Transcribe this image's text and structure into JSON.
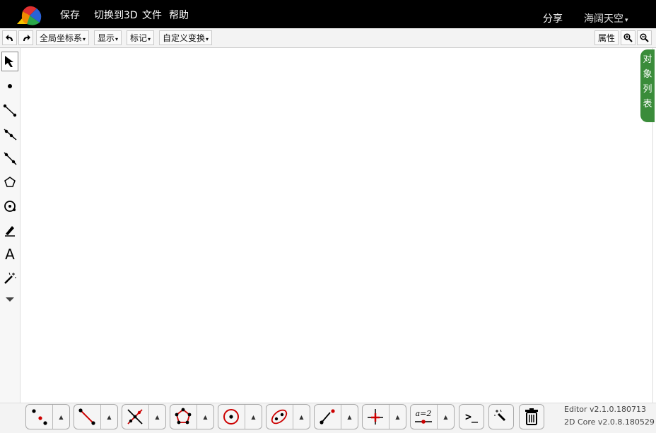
{
  "header": {
    "menu": [
      "保存",
      "切换到3D",
      "文件",
      "帮助"
    ],
    "share": "分享",
    "user": "海阔天空",
    "user_caret": "▾"
  },
  "toolbar": {
    "undo_icon": "undo-icon",
    "redo_icon": "redo-icon",
    "coord": "全局坐标系",
    "display": "显示",
    "mark": "标记",
    "transform": "自定义变换",
    "caret": "▾",
    "properties": "属性",
    "zoom_in_icon": "zoom-in-icon",
    "zoom_out_icon": "zoom-out-icon"
  },
  "left_tools": [
    "select-arrow-icon",
    "point-icon",
    "segment-icon",
    "ray-icon",
    "line-icon",
    "polygon-icon",
    "circle-icon",
    "pen-icon",
    "text-icon",
    "magic-wand-icon",
    "more-icon"
  ],
  "left_text_tool": "A",
  "object_list": {
    "chars": [
      "对",
      "象",
      "列",
      "表"
    ]
  },
  "bottom_tools": {
    "groups": [
      "points-tool",
      "segment-tool",
      "intersect-tool",
      "polygon-tool",
      "circle-tool",
      "conic-tool",
      "ray-tool",
      "axes-tool",
      "parameter-tool"
    ],
    "arrow": "▲",
    "param_label": "a=2",
    "console_label": ">_"
  },
  "version": {
    "editor": "Editor v2.1.0.180713",
    "core": "2D Core v2.0.8.180529"
  },
  "colors": {
    "accent_red": "#cc0000",
    "panel_green": "#3a8c3a"
  }
}
